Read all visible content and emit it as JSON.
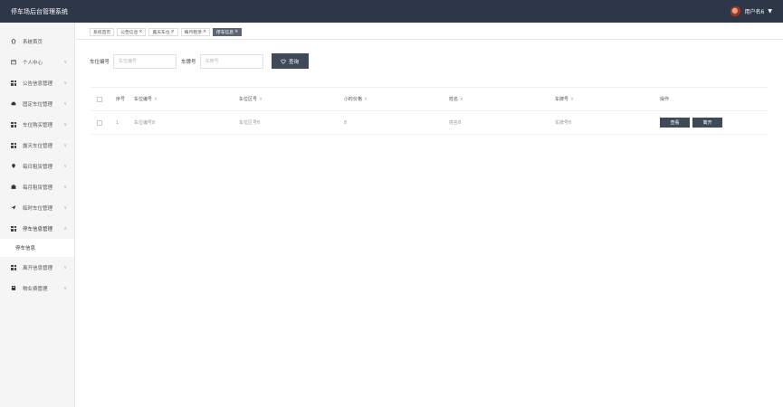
{
  "app": {
    "title": "停车场后台管理系统"
  },
  "user": {
    "name": "用户名6"
  },
  "sidebar": {
    "items": [
      {
        "label": "系统首页",
        "icon": "home-icon",
        "has_arrow": false
      },
      {
        "label": "个人中心",
        "icon": "calendar-icon",
        "has_arrow": true
      },
      {
        "label": "公告信息管理",
        "icon": "grid-icon",
        "has_arrow": true
      },
      {
        "label": "固定车位管理",
        "icon": "car-icon",
        "has_arrow": true
      },
      {
        "label": "车位购买管理",
        "icon": "grid-icon",
        "has_arrow": true
      },
      {
        "label": "露天车位管理",
        "icon": "grid-icon",
        "has_arrow": true
      },
      {
        "label": "每日租赁管理",
        "icon": "location-icon",
        "has_arrow": true
      },
      {
        "label": "每月租赁管理",
        "icon": "briefcase-icon",
        "has_arrow": true
      },
      {
        "label": "临时车位管理",
        "icon": "plane-icon",
        "has_arrow": true
      },
      {
        "label": "停车信息管理",
        "icon": "grid-icon",
        "has_arrow": true,
        "expanded": true
      },
      {
        "label": "离开信息管理",
        "icon": "grid-icon",
        "has_arrow": true
      },
      {
        "label": "物业费管理",
        "icon": "calculator-icon",
        "has_arrow": true
      }
    ],
    "submenu": {
      "label": "停车信息"
    }
  },
  "tabs": [
    {
      "label": "系统首页",
      "closable": false,
      "active": false
    },
    {
      "label": "公告信息",
      "closable": true,
      "active": false
    },
    {
      "label": "露天车位",
      "closable": true,
      "active": false
    },
    {
      "label": "每月租赁",
      "closable": true,
      "active": false
    },
    {
      "label": "停车信息",
      "closable": true,
      "active": true
    }
  ],
  "search": {
    "field1_label": "车位编号",
    "field1_placeholder": "车位编号",
    "field2_label": "车牌号",
    "field2_placeholder": "车牌号",
    "button_label": "查询"
  },
  "table": {
    "columns": [
      "序号",
      "车位编号",
      "车位区号",
      "小时价格",
      "姓名",
      "车牌号",
      "操作"
    ],
    "rows": [
      {
        "index": "1",
        "space_no": "车位编号8",
        "zone_no": "车位区号8",
        "hourly_price": "8",
        "name": "姓名8",
        "plate": "车牌号8"
      }
    ],
    "actions": {
      "view_label": "查看",
      "leave_label": "离开"
    }
  },
  "colors": {
    "header_bg": "#2d3748",
    "button_bg": "#3f4a59",
    "active_tab_bg": "#5c6675"
  }
}
